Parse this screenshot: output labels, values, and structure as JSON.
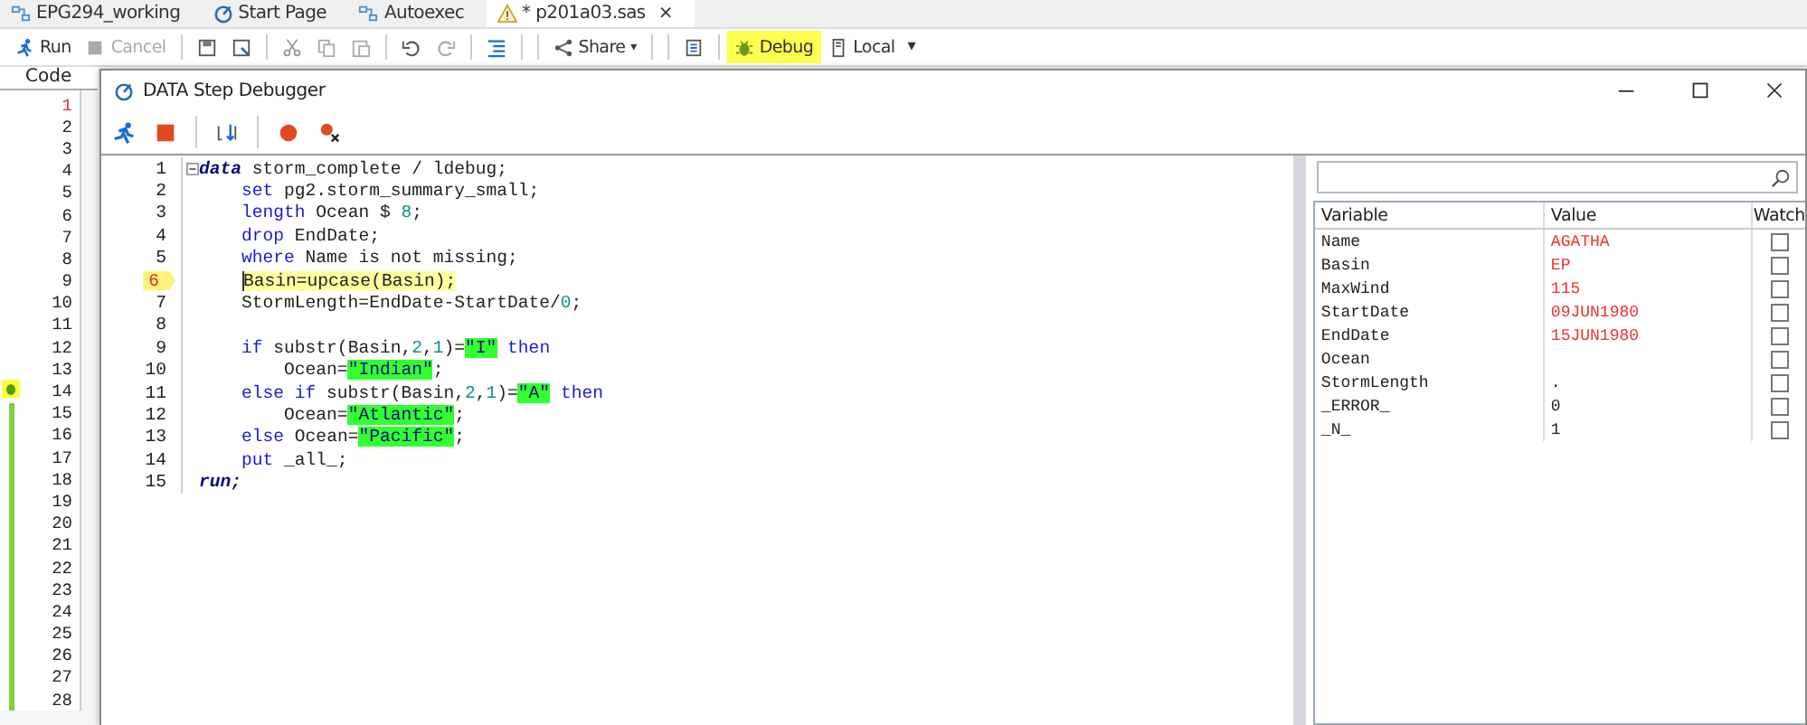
{
  "tabs": [
    {
      "label": "EPG294_working",
      "kind": "flow",
      "selected": false
    },
    {
      "label": "Start Page",
      "kind": "start",
      "selected": false
    },
    {
      "label": "Autoexec",
      "kind": "flow",
      "selected": false
    },
    {
      "label": "* p201a03.sas",
      "kind": "warning",
      "selected": true,
      "close": "×"
    }
  ],
  "toolbar": [
    {
      "kind": "run",
      "label": "Run"
    },
    {
      "kind": "cancel",
      "label": "Cancel",
      "disabled": true
    },
    {
      "kind": "share",
      "label": "Share",
      "caret": "▾"
    },
    {
      "kind": "debug",
      "label": "Debug",
      "selected": true
    },
    {
      "kind": "server",
      "label": "Local",
      "caret": "▾"
    }
  ],
  "editor": {
    "tab": "Code",
    "lines": [
      {
        "number": "1",
        "current": true,
        "marker": false,
        "changed": false
      },
      {
        "number": "2",
        "current": false,
        "marker": false,
        "changed": false
      },
      {
        "number": "3",
        "current": false,
        "marker": false,
        "changed": false
      },
      {
        "number": "4",
        "current": false,
        "marker": false,
        "changed": false
      },
      {
        "number": "5",
        "current": false,
        "marker": false,
        "changed": false
      },
      {
        "number": "6",
        "current": false,
        "marker": false,
        "changed": false
      },
      {
        "number": "7",
        "current": false,
        "marker": false,
        "changed": false
      },
      {
        "number": "8",
        "current": false,
        "marker": false,
        "changed": false
      },
      {
        "number": "9",
        "current": false,
        "marker": false,
        "changed": false
      },
      {
        "number": "10",
        "current": false,
        "marker": false,
        "changed": false
      },
      {
        "number": "11",
        "current": false,
        "marker": false,
        "changed": false
      },
      {
        "number": "12",
        "current": false,
        "marker": false,
        "changed": false
      },
      {
        "number": "13",
        "current": false,
        "marker": false,
        "changed": false
      },
      {
        "number": "14",
        "current": false,
        "marker": true,
        "changed": true
      },
      {
        "number": "15",
        "current": false,
        "marker": false,
        "changed": true
      },
      {
        "number": "16",
        "current": false,
        "marker": false,
        "changed": true
      },
      {
        "number": "17",
        "current": false,
        "marker": false,
        "changed": true
      },
      {
        "number": "18",
        "current": false,
        "marker": false,
        "changed": true
      },
      {
        "number": "19",
        "current": false,
        "marker": false,
        "changed": true
      },
      {
        "number": "20",
        "current": false,
        "marker": false,
        "changed": true
      },
      {
        "number": "21",
        "current": false,
        "marker": false,
        "changed": true
      },
      {
        "number": "22",
        "current": false,
        "marker": false,
        "changed": true
      },
      {
        "number": "23",
        "current": false,
        "marker": false,
        "changed": true
      },
      {
        "number": "24",
        "current": false,
        "marker": false,
        "changed": true
      },
      {
        "number": "25",
        "current": false,
        "marker": false,
        "changed": true
      },
      {
        "number": "26",
        "current": false,
        "marker": false,
        "changed": true
      },
      {
        "number": "27",
        "current": false,
        "marker": false,
        "changed": true
      },
      {
        "number": "28",
        "current": false,
        "marker": false,
        "changed": true
      }
    ]
  },
  "debugger": {
    "title": "DATA Step Debugger",
    "code": [
      {
        "number": "1",
        "current": false,
        "segments": [
          {
            "kind": "step",
            "text": "data"
          },
          {
            "kind": "plain",
            "text": " storm_complete / ldebug;"
          }
        ],
        "children": [
          {
            "number": "2",
            "current": false,
            "segments": [
              {
                "kind": "keyword",
                "text": "set"
              },
              {
                "kind": "plain",
                "text": " pg2.storm_summary_small;"
              }
            ]
          },
          {
            "number": "3",
            "current": false,
            "segments": [
              {
                "kind": "keyword",
                "text": "length"
              },
              {
                "kind": "plain",
                "text": " Ocean $ "
              },
              {
                "kind": "number",
                "text": "8"
              },
              {
                "kind": "plain",
                "text": ";"
              }
            ]
          },
          {
            "number": "4",
            "current": false,
            "segments": [
              {
                "kind": "keyword",
                "text": "drop"
              },
              {
                "kind": "plain",
                "text": " EndDate;"
              }
            ]
          },
          {
            "number": "5",
            "current": false,
            "segments": [
              {
                "kind": "keyword",
                "text": "where"
              },
              {
                "kind": "plain",
                "text": " Name is not missing;"
              }
            ]
          },
          {
            "number": "6",
            "current": true,
            "segments": [
              {
                "kind": "plain",
                "text": "Basin=upcase(Basin);"
              }
            ]
          },
          {
            "number": "7",
            "current": false,
            "segments": [
              {
                "kind": "plain",
                "text": "StormLength=EndDate-StartDate/"
              },
              {
                "kind": "number",
                "text": "0"
              },
              {
                "kind": "plain",
                "text": ";"
              }
            ]
          },
          {
            "number": "8",
            "current": false
          },
          {
            "number": "9",
            "current": false,
            "segments": [
              {
                "kind": "keyword",
                "text": "if"
              },
              {
                "kind": "plain",
                "text": " substr(Basin,"
              },
              {
                "kind": "number",
                "text": "2"
              },
              {
                "kind": "plain",
                "text": ","
              },
              {
                "kind": "number",
                "text": "1"
              },
              {
                "kind": "plain",
                "text": ")="
              },
              {
                "kind": "string",
                "text": "\"I\""
              },
              {
                "kind": "keyword",
                "text": " then"
              }
            ],
            "children": [
              {
                "number": "10",
                "current": false,
                "segments": [
                  {
                    "kind": "plain",
                    "text": "Ocean="
                  },
                  {
                    "kind": "string",
                    "text": "\"Indian\""
                  },
                  {
                    "kind": "plain",
                    "text": ";"
                  }
                ]
              }
            ]
          },
          {
            "number": "11",
            "current": false,
            "segments": [
              {
                "kind": "keyword",
                "text": "else if"
              },
              {
                "kind": "plain",
                "text": " substr(Basin,"
              },
              {
                "kind": "number",
                "text": "2"
              },
              {
                "kind": "plain",
                "text": ","
              },
              {
                "kind": "number",
                "text": "1"
              },
              {
                "kind": "plain",
                "text": ")="
              },
              {
                "kind": "string",
                "text": "\"A\""
              },
              {
                "kind": "keyword",
                "text": " then"
              }
            ],
            "children": [
              {
                "number": "12",
                "current": false,
                "segments": [
                  {
                    "kind": "plain",
                    "text": "Ocean="
                  },
                  {
                    "kind": "string",
                    "text": "\"Atlantic\""
                  },
                  {
                    "kind": "plain",
                    "text": ";"
                  }
                ]
              }
            ]
          },
          {
            "number": "13",
            "current": false,
            "segments": [
              {
                "kind": "keyword",
                "text": "else"
              },
              {
                "kind": "plain",
                "text": " Ocean="
              },
              {
                "kind": "string",
                "text": "\"Pacific\""
              },
              {
                "kind": "plain",
                "text": ";"
              }
            ]
          },
          {
            "number": "14",
            "current": false,
            "segments": [
              {
                "kind": "keyword",
                "text": "put"
              },
              {
                "kind": "plain",
                "text": " _all_;"
              }
            ]
          }
        ]
      },
      {
        "number": "15",
        "current": false,
        "segments": [
          {
            "kind": "step",
            "text": "run;"
          }
        ]
      }
    ],
    "columns": [
      "Variable",
      "Value",
      "Watch"
    ],
    "variables": [
      {
        "name": "Name",
        "value": "AGATHA",
        "changed": true,
        "watch": false
      },
      {
        "name": "Basin",
        "value": "EP",
        "changed": true,
        "watch": false
      },
      {
        "name": "MaxWind",
        "value": "115",
        "changed": true,
        "watch": false
      },
      {
        "name": "StartDate",
        "value": "09JUN1980",
        "changed": true,
        "watch": false
      },
      {
        "name": "EndDate",
        "value": "15JUN1980",
        "changed": true,
        "watch": false
      },
      {
        "name": "Ocean",
        "watch": false
      },
      {
        "name": "StormLength",
        "value": ".",
        "changed": false,
        "watch": false
      },
      {
        "name": "_ERROR_",
        "value": "0",
        "changed": false,
        "watch": false
      },
      {
        "name": "_N_",
        "value": "1",
        "changed": false,
        "watch": false
      }
    ]
  }
}
